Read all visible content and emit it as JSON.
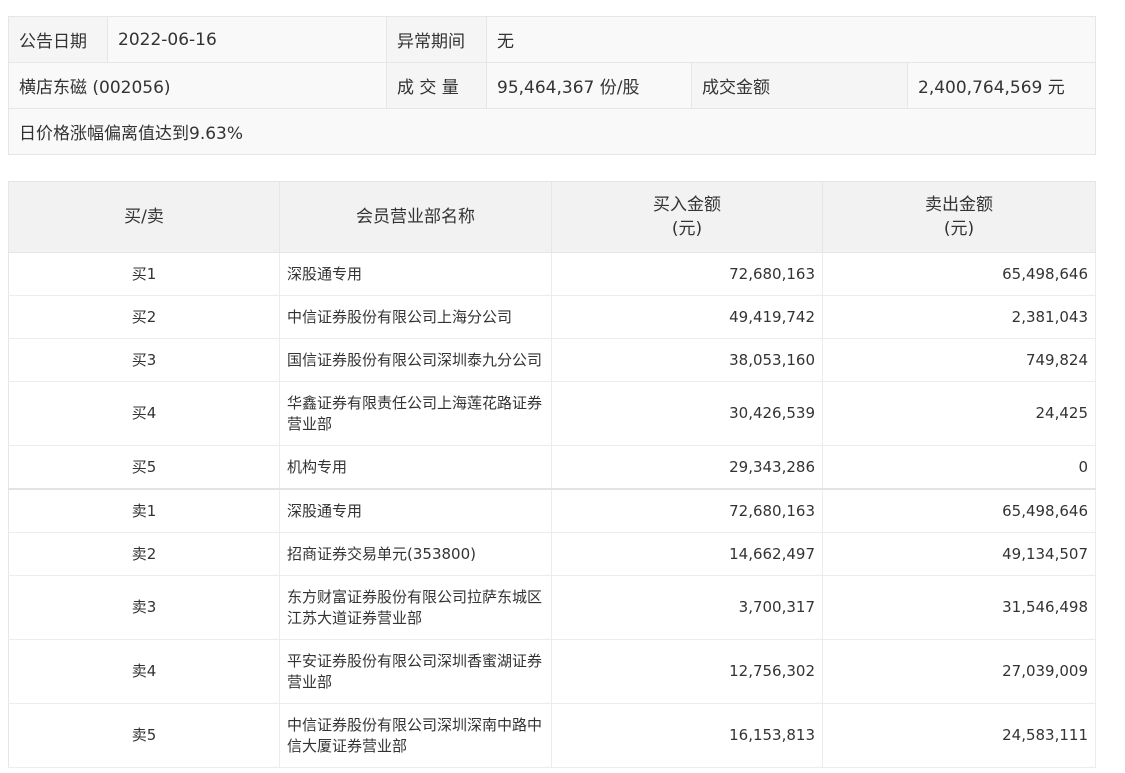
{
  "info": {
    "date_label": "公告日期",
    "date_value": "2022-06-16",
    "period_label": "异常期间",
    "period_value": "无",
    "stock_name": "横店东磁 (002056)",
    "volume_label": "成 交 量",
    "volume_value": "95,464,367 份/股",
    "amount_label": "成交金额",
    "amount_value": "2,400,764,569 元",
    "description": "日价格涨幅偏离值达到9.63%"
  },
  "trade_table": {
    "headers": {
      "side": "买/卖",
      "member": "会员营业部名称",
      "buy_amount_line1": "买入金额",
      "buy_amount_line2": "(元)",
      "sell_amount_line1": "卖出金额",
      "sell_amount_line2": "(元)"
    },
    "rows": [
      {
        "side": "买1",
        "member": "深股通专用",
        "buy": "72,680,163",
        "sell": "65,498,646"
      },
      {
        "side": "买2",
        "member": "中信证券股份有限公司上海分公司",
        "buy": "49,419,742",
        "sell": "2,381,043"
      },
      {
        "side": "买3",
        "member": "国信证券股份有限公司深圳泰九分公司",
        "buy": "38,053,160",
        "sell": "749,824"
      },
      {
        "side": "买4",
        "member": "华鑫证券有限责任公司上海莲花路证券营业部",
        "buy": "30,426,539",
        "sell": "24,425"
      },
      {
        "side": "买5",
        "member": "机构专用",
        "buy": "29,343,286",
        "sell": "0"
      },
      {
        "side": "卖1",
        "member": "深股通专用",
        "buy": "72,680,163",
        "sell": "65,498,646"
      },
      {
        "side": "卖2",
        "member": "招商证券交易单元(353800)",
        "buy": "14,662,497",
        "sell": "49,134,507"
      },
      {
        "side": "卖3",
        "member": "东方财富证券股份有限公司拉萨东城区江苏大道证券营业部",
        "buy": "3,700,317",
        "sell": "31,546,498"
      },
      {
        "side": "卖4",
        "member": "平安证券股份有限公司深圳香蜜湖证券营业部",
        "buy": "12,756,302",
        "sell": "27,039,009"
      },
      {
        "side": "卖5",
        "member": "中信证券股份有限公司深圳深南中路中信大厦证券营业部",
        "buy": "16,153,813",
        "sell": "24,583,111"
      }
    ]
  }
}
